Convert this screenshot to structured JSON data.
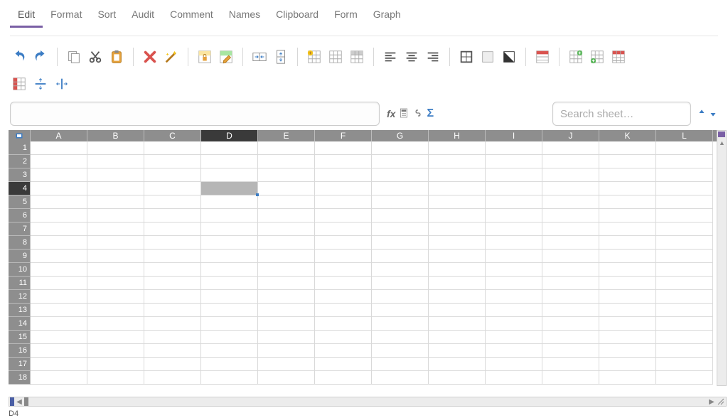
{
  "menu": {
    "items": [
      "Edit",
      "Format",
      "Sort",
      "Audit",
      "Comment",
      "Names",
      "Clipboard",
      "Form",
      "Graph"
    ],
    "active": 0
  },
  "toolbar": {
    "row1": [
      "undo",
      "redo",
      "sep",
      "copy",
      "cut",
      "paste",
      "sep",
      "delete",
      "wand",
      "sep",
      "lock-cell",
      "edit-cell",
      "sep",
      "merge-h",
      "merge-v",
      "sep",
      "insert-sheet",
      "grid-plain",
      "grid-header",
      "sep",
      "align-left",
      "align-center",
      "align-right",
      "sep",
      "borders",
      "fill",
      "contrast",
      "sep",
      "table-style",
      "sep",
      "insert-col",
      "insert-row",
      "delete-col"
    ],
    "row2": [
      "freeze-panes",
      "split-h",
      "split-v"
    ]
  },
  "formula": {
    "value": ""
  },
  "fx": {
    "fx": "fx",
    "calc": "calc",
    "link": "link",
    "sigma": "Σ"
  },
  "search": {
    "placeholder": "Search sheet…"
  },
  "grid": {
    "columns": [
      "A",
      "B",
      "C",
      "D",
      "E",
      "F",
      "G",
      "H",
      "I",
      "J",
      "K",
      "L"
    ],
    "rows": 18,
    "activeCell": "D4",
    "activeCol": 3,
    "activeRow": 3
  },
  "status": {
    "ref": "D4"
  }
}
